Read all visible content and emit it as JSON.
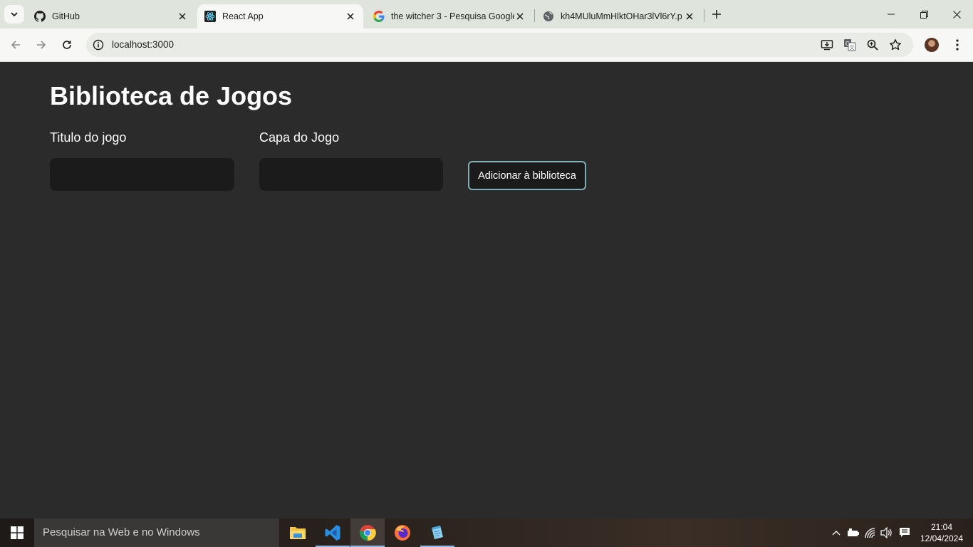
{
  "browser": {
    "tabs": [
      {
        "title": "GitHub",
        "icon": "github-icon",
        "active": false
      },
      {
        "title": "React App",
        "icon": "react-icon",
        "active": true
      },
      {
        "title": "the witcher 3 - Pesquisa Google",
        "icon": "google-icon",
        "active": false
      },
      {
        "title": "kh4MUluMmHlktOHar3lVl6rY.p",
        "icon": "globe-icon",
        "active": false
      }
    ],
    "url": "localhost:3000"
  },
  "page": {
    "title": "Biblioteca de Jogos",
    "form": {
      "title_label": "Titulo do jogo",
      "title_value": "",
      "cover_label": "Capa do Jogo",
      "cover_value": "",
      "submit_label": "Adicionar à biblioteca"
    }
  },
  "taskbar": {
    "search_placeholder": "Pesquisar na Web e no Windows",
    "apps": [
      "file-explorer-icon",
      "vscode-icon",
      "chrome-icon",
      "firefox-icon",
      "notepad-icon"
    ],
    "time": "21:04",
    "date": "12/04/2024"
  }
}
